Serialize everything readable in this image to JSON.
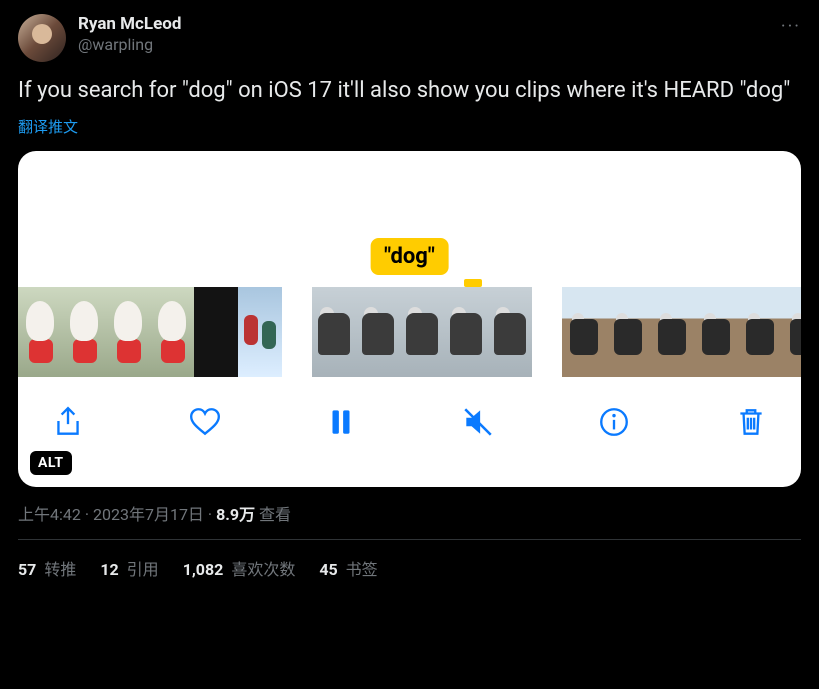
{
  "author": {
    "displayName": "Ryan McLeod",
    "handle": "@warpling"
  },
  "moreLabel": "···",
  "bodyText": "If you search for \"dog\" on iOS 17 it'll also show you clips where it's HEARD \"dog\"",
  "translateLabel": "翻译推文",
  "card": {
    "keywordLabel": "\"dog\"",
    "altBadge": "ALT",
    "toolbar": {
      "share": "share-icon",
      "like": "heart-icon",
      "pause": "pause-icon",
      "mute": "mute-icon",
      "info": "info-icon",
      "trash": "trash-icon"
    }
  },
  "meta": {
    "time": "上午4:42",
    "separator1": " · ",
    "date": "2023年7月17日",
    "separator2": " · ",
    "viewsCount": "8.9万",
    "viewsLabel": " 查看"
  },
  "stats": {
    "retweets": {
      "n": "57",
      "label": " 转推"
    },
    "quotes": {
      "n": "12",
      "label": " 引用"
    },
    "likes": {
      "n": "1,082",
      "label": " 喜欢次数"
    },
    "bookmarks": {
      "n": "45",
      "label": " 书签"
    }
  }
}
